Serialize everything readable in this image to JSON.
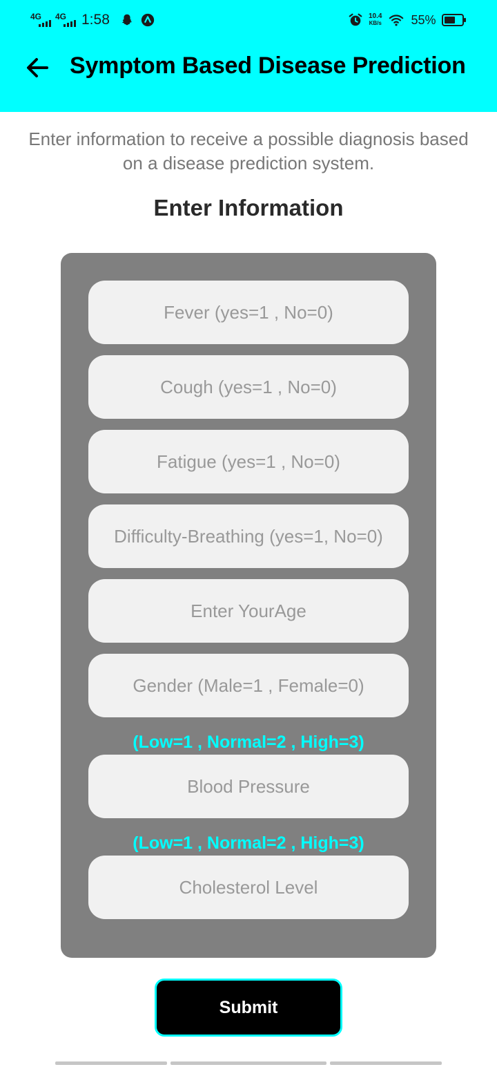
{
  "status_bar": {
    "network_1": "4G",
    "network_2": "4G",
    "time": "1:58",
    "speed_value": "10.4",
    "speed_unit": "KB/s",
    "battery_percent": "55%"
  },
  "toolbar": {
    "title": "Symptom Based Disease Prediction",
    "back_icon": "arrow-left-icon"
  },
  "intro_text": "Enter information to receive a possible diagnosis based on a disease prediction system.",
  "section_title": "Enter Information",
  "form": {
    "fever_placeholder": "Fever (yes=1 , No=0)",
    "cough_placeholder": "Cough (yes=1 , No=0)",
    "fatigue_placeholder": "Fatigue (yes=1 , No=0)",
    "breathing_placeholder": "Difficulty-Breathing (yes=1, No=0)",
    "age_placeholder": "Enter YourAge",
    "gender_placeholder": "Gender (Male=1 , Female=0)",
    "blood_pressure_hint": "(Low=1 , Normal=2 , High=3)",
    "blood_pressure_placeholder": "Blood Pressure",
    "cholesterol_hint": "(Low=1 , Normal=2 , High=3)",
    "cholesterol_placeholder": "Cholesterol Level"
  },
  "submit_label": "Submit",
  "colors": {
    "accent": "#00ffff",
    "card": "#808080",
    "field": "#f1f1f1"
  }
}
